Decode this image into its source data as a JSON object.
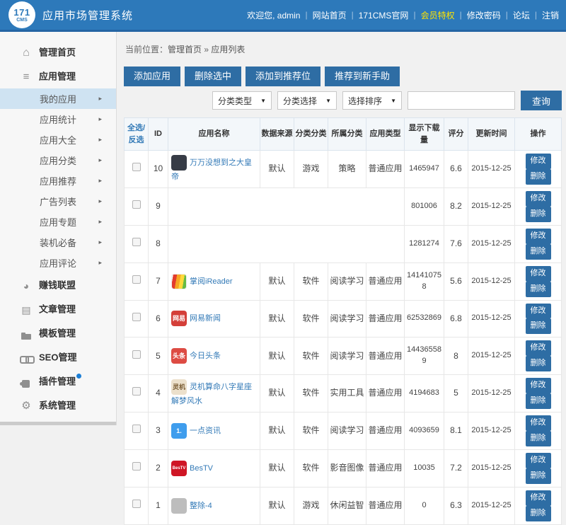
{
  "header": {
    "logo_top": "171",
    "logo_bottom": "CMS",
    "title": "应用市场管理系统",
    "welcome": "欢迎您, admin",
    "links": [
      {
        "key": "site-home",
        "label": "网站首页",
        "vip": false
      },
      {
        "key": "official-site",
        "label": "171CMS官网",
        "vip": false
      },
      {
        "key": "vip-privilege",
        "label": "会员特权",
        "vip": true
      },
      {
        "key": "change-password",
        "label": "修改密码",
        "vip": false
      },
      {
        "key": "forum",
        "label": "论坛",
        "vip": false
      },
      {
        "key": "logout",
        "label": "注销",
        "vip": false
      }
    ],
    "colors": {
      "bar": "#2d79ba",
      "bar_border": "#2465a4",
      "vip": "#ffe400"
    }
  },
  "sidebar": {
    "items": [
      {
        "key": "admin-home",
        "label": "管理首页",
        "icon": "home",
        "type": "top"
      },
      {
        "key": "app-management",
        "label": "应用管理",
        "icon": "menu",
        "type": "top"
      },
      {
        "key": "my-apps",
        "label": "我的应用",
        "type": "sub",
        "active": true,
        "arrow": true
      },
      {
        "key": "app-statistics",
        "label": "应用统计",
        "type": "sub",
        "arrow": true
      },
      {
        "key": "app-complete",
        "label": "应用大全",
        "type": "sub",
        "arrow": true
      },
      {
        "key": "app-categories",
        "label": "应用分类",
        "type": "sub",
        "arrow": true
      },
      {
        "key": "app-recommend",
        "label": "应用推荐",
        "type": "sub",
        "arrow": true
      },
      {
        "key": "ad-list",
        "label": "广告列表",
        "type": "sub",
        "arrow": true
      },
      {
        "key": "app-topics",
        "label": "应用专题",
        "type": "sub",
        "arrow": true
      },
      {
        "key": "essential-installs",
        "label": "装机必备",
        "type": "sub",
        "arrow": true
      },
      {
        "key": "app-comments",
        "label": "应用评论",
        "type": "sub",
        "arrow": true
      },
      {
        "key": "money-alliance",
        "label": "赚钱联盟",
        "icon": "pie",
        "type": "top"
      },
      {
        "key": "article-management",
        "label": "文章管理",
        "icon": "doc",
        "type": "top"
      },
      {
        "key": "template-management",
        "label": "模板管理",
        "icon": "folder",
        "type": "top"
      },
      {
        "key": "seo-management",
        "label": "SEO管理",
        "icon": "link",
        "type": "top"
      },
      {
        "key": "plugin-management",
        "label": "插件管理",
        "icon": "puzzle",
        "type": "top",
        "badge": true
      },
      {
        "key": "system-management",
        "label": "系统管理",
        "icon": "gear",
        "type": "top"
      }
    ],
    "active_bg": "#cfe3f2"
  },
  "breadcrumb": {
    "prefix": "当前位置：",
    "home": "管理首页",
    "separator": "»",
    "current": "应用列表"
  },
  "toolbar": {
    "buttons": [
      {
        "key": "add-app",
        "label": "添加应用"
      },
      {
        "key": "delete-selected",
        "label": "删除选中"
      },
      {
        "key": "add-to-recommend",
        "label": "添加到推荐位"
      },
      {
        "key": "recommend-to-newbie",
        "label": "推荐到新手助"
      }
    ],
    "filters": {
      "selects": [
        {
          "key": "cat-type-select",
          "label": "分类类型"
        },
        {
          "key": "cat-select",
          "label": "分类选择"
        },
        {
          "key": "sort-select",
          "label": "选择排序"
        }
      ],
      "search_value": "",
      "search_placeholder": "",
      "query_label": "查询"
    },
    "button_color": "#2e6da4"
  },
  "table": {
    "headers": [
      {
        "key": "select-all",
        "label": "全选/反选"
      },
      {
        "key": "id",
        "label": "ID"
      },
      {
        "key": "app-name",
        "label": "应用名称"
      },
      {
        "key": "data-source",
        "label": "数据来源"
      },
      {
        "key": "cat-type",
        "label": "分类分类"
      },
      {
        "key": "category",
        "label": "所属分类"
      },
      {
        "key": "app-type",
        "label": "应用类型"
      },
      {
        "key": "downloads",
        "label": "显示下载量"
      },
      {
        "key": "score",
        "label": "评分"
      },
      {
        "key": "updated-time",
        "label": "更新时间"
      },
      {
        "key": "actions",
        "label": "操作"
      }
    ],
    "action_labels": [
      "修改",
      "删除"
    ],
    "link_color": "#337ab7",
    "rows": [
      {
        "id": "10",
        "name": "万万没想到之大皇帝",
        "icon": {
          "bg": "#373c46",
          "label": "",
          "fg": "#ffffff"
        },
        "source": "默认",
        "cat_type": "游戏",
        "category": "策略",
        "app_type": "普通应用",
        "downloads": "1465947",
        "score": "6.6",
        "updated": "2015-12-25"
      },
      {
        "id": "9",
        "name": "",
        "icon": null,
        "source": "",
        "cat_type": "",
        "category": "",
        "app_type": "",
        "downloads": "801006",
        "score": "8.2",
        "updated": "2015-12-25"
      },
      {
        "id": "8",
        "name": "",
        "icon": null,
        "source": "",
        "cat_type": "",
        "category": "",
        "app_type": "",
        "downloads": "1281274",
        "score": "7.6",
        "updated": "2015-12-25"
      },
      {
        "id": "7",
        "name": "掌阅iReader",
        "icon": {
          "stripes": true,
          "label": ""
        },
        "source": "默认",
        "cat_type": "软件",
        "category": "阅读学习",
        "app_type": "普通应用",
        "downloads": "141410758",
        "score": "5.6",
        "updated": "2015-12-25"
      },
      {
        "id": "6",
        "name": "网易新闻",
        "icon": {
          "bg": "#d43f39",
          "label": "网易",
          "fg": "#ffffff"
        },
        "source": "默认",
        "cat_type": "软件",
        "category": "阅读学习",
        "app_type": "普通应用",
        "downloads": "62532869",
        "score": "6.8",
        "updated": "2015-12-25"
      },
      {
        "id": "5",
        "name": "今日头条",
        "icon": {
          "bg": "#dd4b43",
          "label": "头条",
          "fg": "#ffffff"
        },
        "source": "默认",
        "cat_type": "软件",
        "category": "阅读学习",
        "app_type": "普通应用",
        "downloads": "144365589",
        "score": "8",
        "updated": "2015-12-25"
      },
      {
        "id": "4",
        "name": "灵机算命八字星座解梦风水",
        "icon": {
          "bg": "#ece0cb",
          "label": "灵机",
          "fg": "#7a5c33"
        },
        "source": "默认",
        "cat_type": "软件",
        "category": "实用工具",
        "app_type": "普通应用",
        "downloads": "4194683",
        "score": "5",
        "updated": "2015-12-25"
      },
      {
        "id": "3",
        "name": "一点资讯",
        "icon": {
          "bg": "#3f9ded",
          "label": "1.",
          "fg": "#ffffff"
        },
        "source": "默认",
        "cat_type": "软件",
        "category": "阅读学习",
        "app_type": "普通应用",
        "downloads": "4093659",
        "score": "8.1",
        "updated": "2015-12-25"
      },
      {
        "id": "2",
        "name": "BesTV",
        "icon": {
          "bg": "#cf1625",
          "label": "BesTV",
          "fg": "#ffffff"
        },
        "source": "默认",
        "cat_type": "软件",
        "category": "影音图像",
        "app_type": "普通应用",
        "downloads": "10035",
        "score": "7.2",
        "updated": "2015-12-25"
      },
      {
        "id": "1",
        "name": "整除-4",
        "icon": {
          "bg": "#bdbdbd",
          "label": "",
          "fg": "#888888"
        },
        "source": "默认",
        "cat_type": "游戏",
        "category": "休闲益智",
        "app_type": "普通应用",
        "downloads": "0",
        "score": "6.3",
        "updated": "2015-12-25"
      }
    ]
  }
}
